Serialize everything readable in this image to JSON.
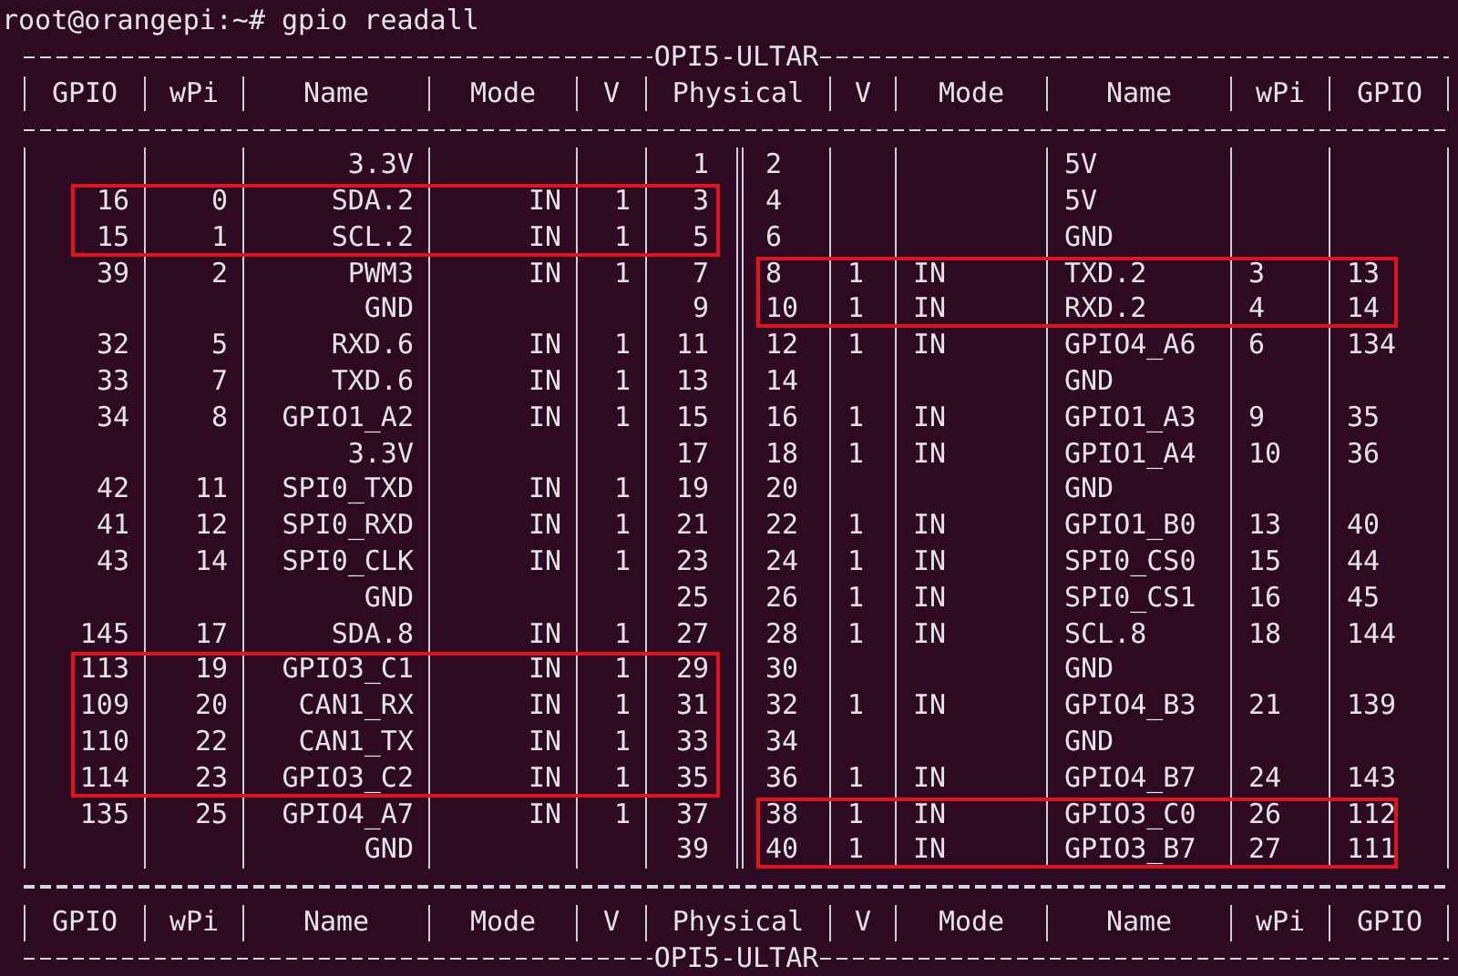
{
  "prompt": "root@orangepi:~# gpio readall",
  "board_title_top": "OPI5-ULTAR",
  "header_top": [
    "GPIO",
    "wPi",
    "Name",
    "Mode",
    "V",
    "Physical",
    "V",
    "Mode",
    "Name",
    "wPi",
    "GPIO"
  ],
  "rows": [
    {
      "left": {
        "name": "3.3V",
        "physical": "1"
      },
      "right": {
        "physical": "2",
        "name": "5V"
      },
      "highlight_left": false,
      "highlight_right": false
    },
    {
      "left": {
        "gpio": "16",
        "wpi": "0",
        "name": "SDA.2",
        "mode": "IN",
        "v": "1",
        "physical": "3"
      },
      "right": {
        "physical": "4",
        "name": "5V"
      },
      "highlight_left": true,
      "highlight_right": false
    },
    {
      "left": {
        "gpio": "15",
        "wpi": "1",
        "name": "SCL.2",
        "mode": "IN",
        "v": "1",
        "physical": "5"
      },
      "right": {
        "physical": "6",
        "name": "GND"
      },
      "highlight_left": true,
      "highlight_right": false
    },
    {
      "left": {
        "gpio": "39",
        "wpi": "2",
        "name": "PWM3",
        "mode": "IN",
        "v": "1",
        "physical": "7"
      },
      "right": {
        "physical": "8",
        "v": "1",
        "mode": "IN",
        "name": "TXD.2",
        "wpi": "3",
        "gpio": "13"
      },
      "highlight_left": false,
      "highlight_right": true
    },
    {
      "left": {
        "name": "GND",
        "physical": "9"
      },
      "right": {
        "physical": "10",
        "v": "1",
        "mode": "IN",
        "name": "RXD.2",
        "wpi": "4",
        "gpio": "14"
      },
      "highlight_left": false,
      "highlight_right": true
    },
    {
      "left": {
        "gpio": "32",
        "wpi": "5",
        "name": "RXD.6",
        "mode": "IN",
        "v": "1",
        "physical": "11"
      },
      "right": {
        "physical": "12",
        "v": "1",
        "mode": "IN",
        "name": "GPIO4_A6",
        "wpi": "6",
        "gpio": "134"
      },
      "highlight_left": false,
      "highlight_right": false
    },
    {
      "left": {
        "gpio": "33",
        "wpi": "7",
        "name": "TXD.6",
        "mode": "IN",
        "v": "1",
        "physical": "13"
      },
      "right": {
        "physical": "14",
        "name": "GND"
      },
      "highlight_left": false,
      "highlight_right": false
    },
    {
      "left": {
        "gpio": "34",
        "wpi": "8",
        "name": "GPIO1_A2",
        "mode": "IN",
        "v": "1",
        "physical": "15"
      },
      "right": {
        "physical": "16",
        "v": "1",
        "mode": "IN",
        "name": "GPIO1_A3",
        "wpi": "9",
        "gpio": "35"
      },
      "highlight_left": false,
      "highlight_right": false
    },
    {
      "left": {
        "name": "3.3V",
        "physical": "17"
      },
      "right": {
        "physical": "18",
        "v": "1",
        "mode": "IN",
        "name": "GPIO1_A4",
        "wpi": "10",
        "gpio": "36"
      },
      "highlight_left": false,
      "highlight_right": false
    },
    {
      "left": {
        "gpio": "42",
        "wpi": "11",
        "name": "SPI0_TXD",
        "mode": "IN",
        "v": "1",
        "physical": "19"
      },
      "right": {
        "physical": "20",
        "name": "GND"
      },
      "highlight_left": false,
      "highlight_right": false
    },
    {
      "left": {
        "gpio": "41",
        "wpi": "12",
        "name": "SPI0_RXD",
        "mode": "IN",
        "v": "1",
        "physical": "21"
      },
      "right": {
        "physical": "22",
        "v": "1",
        "mode": "IN",
        "name": "GPIO1_B0",
        "wpi": "13",
        "gpio": "40"
      },
      "highlight_left": false,
      "highlight_right": false
    },
    {
      "left": {
        "gpio": "43",
        "wpi": "14",
        "name": "SPI0_CLK",
        "mode": "IN",
        "v": "1",
        "physical": "23"
      },
      "right": {
        "physical": "24",
        "v": "1",
        "mode": "IN",
        "name": "SPI0_CS0",
        "wpi": "15",
        "gpio": "44"
      },
      "highlight_left": false,
      "highlight_right": false
    },
    {
      "left": {
        "name": "GND",
        "physical": "25"
      },
      "right": {
        "physical": "26",
        "v": "1",
        "mode": "IN",
        "name": "SPI0_CS1",
        "wpi": "16",
        "gpio": "45"
      },
      "highlight_left": false,
      "highlight_right": false
    },
    {
      "left": {
        "gpio": "145",
        "wpi": "17",
        "name": "SDA.8",
        "mode": "IN",
        "v": "1",
        "physical": "27"
      },
      "right": {
        "physical": "28",
        "v": "1",
        "mode": "IN",
        "name": "SCL.8",
        "wpi": "18",
        "gpio": "144"
      },
      "highlight_left": false,
      "highlight_right": false
    },
    {
      "left": {
        "gpio": "113",
        "wpi": "19",
        "name": "GPIO3_C1",
        "mode": "IN",
        "v": "1",
        "physical": "29"
      },
      "right": {
        "physical": "30",
        "name": "GND"
      },
      "highlight_left": true,
      "highlight_right": false
    },
    {
      "left": {
        "gpio": "109",
        "wpi": "20",
        "name": "CAN1_RX",
        "mode": "IN",
        "v": "1",
        "physical": "31"
      },
      "right": {
        "physical": "32",
        "v": "1",
        "mode": "IN",
        "name": "GPIO4_B3",
        "wpi": "21",
        "gpio": "139"
      },
      "highlight_left": true,
      "highlight_right": false
    },
    {
      "left": {
        "gpio": "110",
        "wpi": "22",
        "name": "CAN1_TX",
        "mode": "IN",
        "v": "1",
        "physical": "33"
      },
      "right": {
        "physical": "34",
        "name": "GND"
      },
      "highlight_left": true,
      "highlight_right": false
    },
    {
      "left": {
        "gpio": "114",
        "wpi": "23",
        "name": "GPIO3_C2",
        "mode": "IN",
        "v": "1",
        "physical": "35"
      },
      "right": {
        "physical": "36",
        "v": "1",
        "mode": "IN",
        "name": "GPIO4_B7",
        "wpi": "24",
        "gpio": "143"
      },
      "highlight_left": true,
      "highlight_right": false
    },
    {
      "left": {
        "gpio": "135",
        "wpi": "25",
        "name": "GPIO4_A7",
        "mode": "IN",
        "v": "1",
        "physical": "37"
      },
      "right": {
        "physical": "38",
        "v": "1",
        "mode": "IN",
        "name": "GPIO3_C0",
        "wpi": "26",
        "gpio": "112"
      },
      "highlight_left": false,
      "highlight_right": true
    },
    {
      "left": {
        "name": "GND",
        "physical": "39"
      },
      "right": {
        "physical": "40",
        "v": "1",
        "mode": "IN",
        "name": "GPIO3_B7",
        "wpi": "27",
        "gpio": "111"
      },
      "highlight_left": false,
      "highlight_right": true
    }
  ],
  "header_bottom": [
    "GPIO",
    "wPi",
    "Name",
    "Mode",
    "V",
    "Physical",
    "V",
    "Mode",
    "Name",
    "wPi",
    "GPIO"
  ],
  "board_title_bottom": "OPI5-ULTAR"
}
